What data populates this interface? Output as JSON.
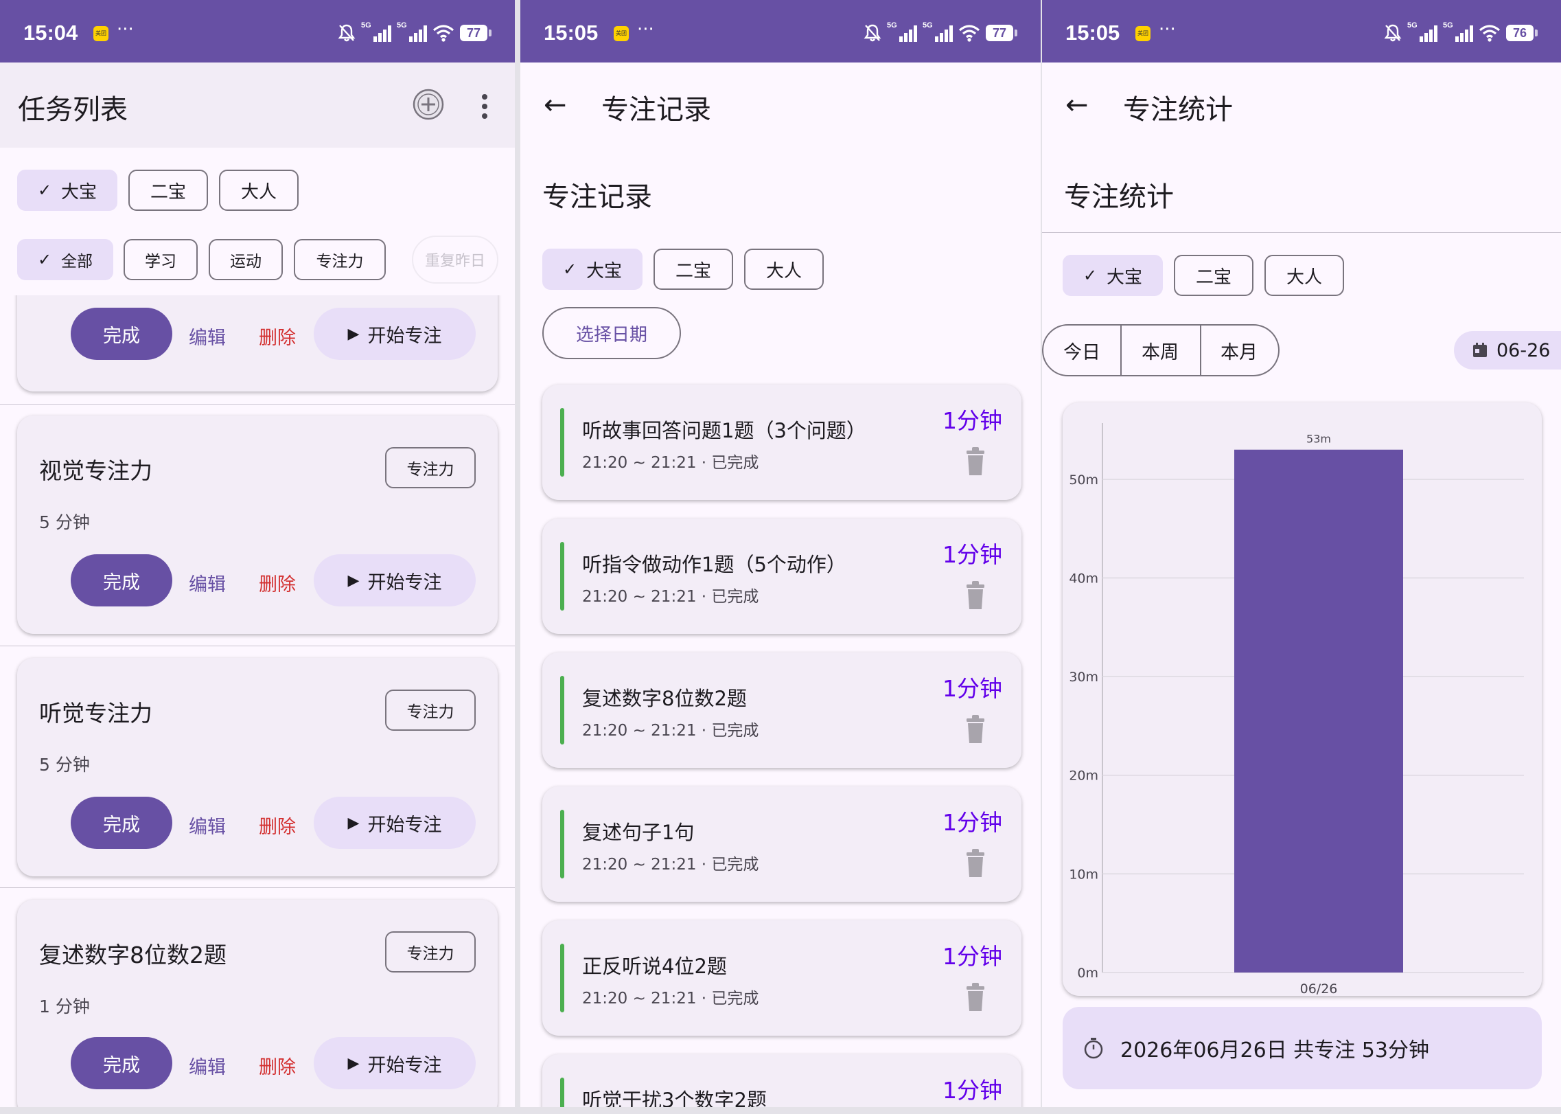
{
  "screen1": {
    "status": {
      "time": "15:04",
      "battery": "77"
    },
    "title": "任务列表",
    "children": [
      {
        "label": "大宝",
        "selected": true
      },
      {
        "label": "二宝",
        "selected": false
      },
      {
        "label": "大人",
        "selected": false
      }
    ],
    "categories": [
      {
        "label": "全部",
        "selected": true
      },
      {
        "label": "学习",
        "selected": false
      },
      {
        "label": "运动",
        "selected": false
      },
      {
        "label": "专注力",
        "selected": false
      }
    ],
    "repeat_label": "重复昨日",
    "actions": {
      "done": "完成",
      "edit": "编辑",
      "delete": "删除",
      "start": "开始专注"
    },
    "tasks": [
      {
        "title": "视觉专注力",
        "duration": "5 分钟",
        "tag": "专注力"
      },
      {
        "title": "听觉专注力",
        "duration": "5 分钟",
        "tag": "专注力"
      },
      {
        "title": "复述数字8位数2题",
        "duration": "1 分钟",
        "tag": "专注力"
      }
    ]
  },
  "screen2": {
    "status": {
      "time": "15:05",
      "battery": "77"
    },
    "appbar_title": "专注记录",
    "heading": "专注记录",
    "children": [
      {
        "label": "大宝",
        "selected": true
      },
      {
        "label": "二宝",
        "selected": false
      },
      {
        "label": "大人",
        "selected": false
      }
    ],
    "date_button": "选择日期",
    "records": [
      {
        "title": "听故事回答问题1题（3个问题）",
        "sub": "21:20 ~ 21:21 · 已完成",
        "duration": "1分钟"
      },
      {
        "title": "听指令做动作1题（5个动作）",
        "sub": "21:20 ~ 21:21 · 已完成",
        "duration": "1分钟"
      },
      {
        "title": "复述数字8位数2题",
        "sub": "21:20 ~ 21:21 · 已完成",
        "duration": "1分钟"
      },
      {
        "title": "复述句子1句",
        "sub": "21:20 ~ 21:21 · 已完成",
        "duration": "1分钟"
      },
      {
        "title": "正反听说4位2题",
        "sub": "21:20 ~ 21:21 · 已完成",
        "duration": "1分钟"
      },
      {
        "title": "听觉干扰3个数字2题",
        "sub": "",
        "duration": "1分钟"
      }
    ]
  },
  "screen3": {
    "status": {
      "time": "15:05",
      "battery": "76"
    },
    "appbar_title": "专注统计",
    "heading": "专注统计",
    "children": [
      {
        "label": "大宝",
        "selected": true
      },
      {
        "label": "二宝",
        "selected": false
      },
      {
        "label": "大人",
        "selected": false
      }
    ],
    "periods": [
      "今日",
      "本周",
      "本月"
    ],
    "date_chip": "06-26",
    "summary": "2026年06月26日 共专注 53分钟"
  },
  "chart_data": {
    "type": "bar",
    "categories": [
      "06/26"
    ],
    "values": [
      53
    ],
    "data_labels": [
      "53m"
    ],
    "yticks": [
      "0m",
      "10m",
      "20m",
      "30m",
      "40m",
      "50m"
    ],
    "ylim": [
      0,
      55
    ],
    "grid": true,
    "bar_color": "#6750a4"
  },
  "colors": {
    "primary": "#6750a4",
    "container": "#e8def8",
    "surface": "#f3edf7",
    "done_bar": "#4caf50",
    "duration": "#6200ea",
    "delete": "#d32f2f"
  }
}
